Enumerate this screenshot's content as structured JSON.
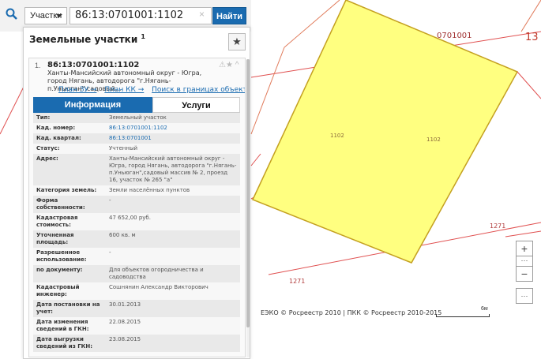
{
  "map": {
    "labels": {
      "block_code": "0701001",
      "district_code": "13",
      "parcel_left": "1102",
      "parcel_right": "1102",
      "neighbor_bottom": "1271",
      "neighbor_right": "1271"
    },
    "colors": {
      "parcel_fill": "#ffff80",
      "parcel_stroke": "#c4a020",
      "boundary": "#e05050"
    },
    "attribution": "ЕЭКО © Росреестр 2010 | ПКК © Росреестр 2010-2015",
    "scale_label": "6м",
    "controls": {
      "zoom_in": "+",
      "zoom_out": "−",
      "more": "···",
      "menu": "···"
    }
  },
  "search": {
    "icon": "search-icon",
    "type_selected": "Участки",
    "query": "86:13:0701001:1102",
    "clear": "×",
    "button_label": "Найти"
  },
  "panel": {
    "title": "Земельные участки",
    "count": "1",
    "favorite_icon": "★",
    "result": {
      "number": "1.",
      "cad_number": "86:13:0701001:1102",
      "address_short": "Ханты-Мансийский автономный округ - Югра, город Нягань, автодорога \"г.Нягань-п.Уньюган\",садовый...",
      "icons": "⚠★ ^",
      "links": [
        "План ЗУ →",
        "План КК →",
        "Поиск в границах объекта →"
      ]
    },
    "tabs": {
      "info": "Информация",
      "services": "Услуги"
    },
    "rows": [
      {
        "key": "Тип:",
        "value": "Земельный участок"
      },
      {
        "key": "Кад. номер:",
        "value": "86:13:0701001:1102",
        "link": true
      },
      {
        "key": "Кад. квартал:",
        "value": "86:13:0701001",
        "link": true
      },
      {
        "key": "Статус:",
        "value": "Учтенный"
      },
      {
        "key": "Адрес:",
        "value": "Ханты-Мансийский автономный округ - Югра, город Нягань, автодорога \"г.Нягань-п.Уньюган\",садовый массив № 2, проезд 16, участок № 265 \"а\""
      },
      {
        "key": "Категория земель:",
        "value": "Земли населённых пунктов"
      },
      {
        "key": "Форма собственности:",
        "value": "-"
      },
      {
        "key": "Кадастровая стоимость:",
        "value": "47 652,00 руб."
      },
      {
        "key": "Уточненная площадь:",
        "value": "600 кв. м"
      },
      {
        "key": "Разрешенное использование:",
        "value": "-"
      },
      {
        "key": "по документу:",
        "value": "Для объектов огородничества и садоводства"
      },
      {
        "key": "Кадастровый инженер:",
        "value": "Сошнянин Александр Викторович"
      },
      {
        "key": "Дата постановки на учет:",
        "value": "30.01.2013"
      },
      {
        "key": "Дата изменения сведений в ГКН:",
        "value": "22.08.2015"
      },
      {
        "key": "Дата выгрузки сведений из ГКН:",
        "value": "23.08.2015"
      }
    ]
  }
}
